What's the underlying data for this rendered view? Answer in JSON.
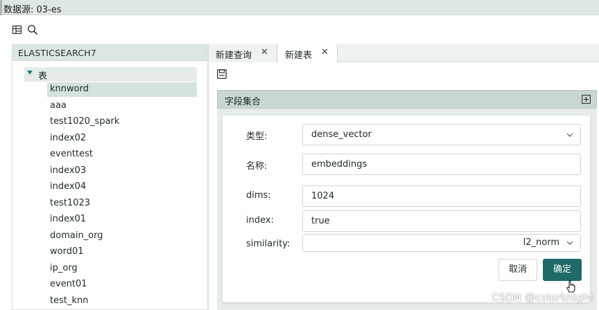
{
  "window": {
    "title": "数据源: 03-es"
  },
  "toolbar": {
    "icons": [
      "grid-table-icon",
      "search-icon"
    ]
  },
  "left_panel": {
    "header": "ELASTICSEARCH7",
    "root": {
      "label": "表",
      "expanded": true
    },
    "items": [
      {
        "label": "knnword",
        "selected": true
      },
      {
        "label": "aaa"
      },
      {
        "label": "test1020_spark"
      },
      {
        "label": "index02"
      },
      {
        "label": "eventtest"
      },
      {
        "label": "index03"
      },
      {
        "label": "index04"
      },
      {
        "label": "test1023"
      },
      {
        "label": "index01"
      },
      {
        "label": "domain_org"
      },
      {
        "label": "word01"
      },
      {
        "label": "ip_org"
      },
      {
        "label": "event01"
      },
      {
        "label": "test_knn"
      }
    ]
  },
  "tabs": [
    {
      "label": "新建查询",
      "close": "✕",
      "active": false
    },
    {
      "label": "新建表",
      "close": "✕",
      "active": true
    }
  ],
  "section": {
    "title": "字段集合"
  },
  "form": {
    "type": {
      "label": "类型:",
      "value": "dense_vector"
    },
    "name": {
      "label": "名称:",
      "value": "embeddings"
    },
    "dims": {
      "label": "dims:",
      "value": "1024"
    },
    "index": {
      "label": "index:",
      "value": "true"
    },
    "similarity": {
      "label": "similarity:",
      "value": "l2_norm"
    }
  },
  "buttons": {
    "cancel": "取消",
    "ok": "确定"
  },
  "watermark": "CSDN @colorknight",
  "colors": {
    "accent": "#1e6a69",
    "header_bg": "#c9d6d3",
    "selected_bg": "#d6e2df"
  }
}
